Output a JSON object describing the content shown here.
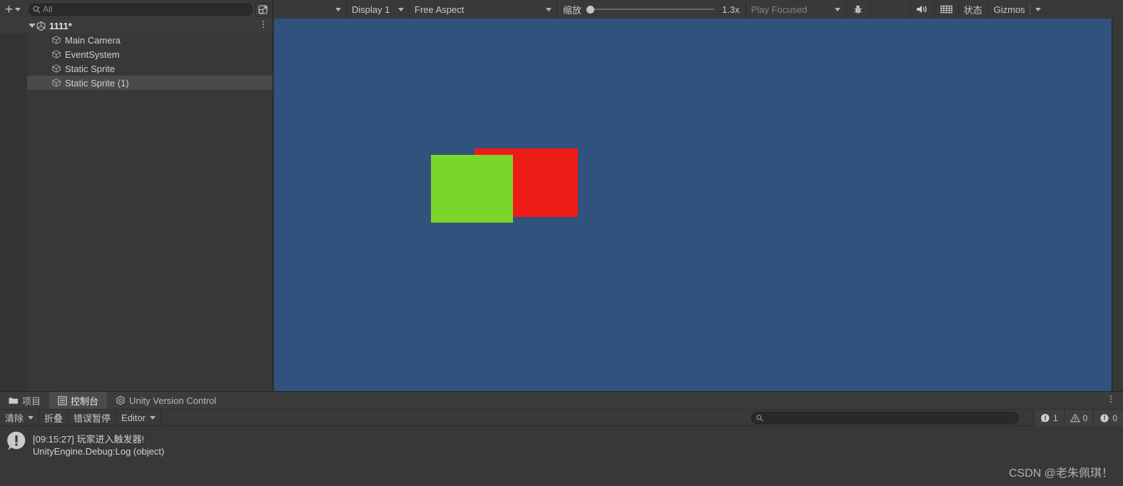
{
  "hierarchy_toolbar": {
    "add_label": "+",
    "add_icon": "plus-icon",
    "search_placeholder": "All",
    "search_value": "",
    "search_icon": "search-icon",
    "popout_icon": "popout-window-icon"
  },
  "game_toolbar": {
    "mode_dropdown_value": "",
    "display_value": "Display 1",
    "aspect_value": "Free Aspect",
    "zoom_label": "缩放",
    "zoom_value": "1.3x",
    "zoom_slider_position_pct": 0,
    "play_focused_value": "Play Focused",
    "debug_icon": "bug-icon",
    "mute_icon": "speaker-icon",
    "stats_grid_icon": "grid-icon",
    "stats_label": "状态",
    "gizmos_label": "Gizmos"
  },
  "hierarchy": {
    "scene_name": "1111*",
    "scene_icon": "unity-logo-icon",
    "menu_icon": "kebab-menu-icon",
    "items": [
      {
        "label": "Main Camera",
        "icon": "gameobject-cube-icon",
        "selected": false
      },
      {
        "label": "EventSystem",
        "icon": "gameobject-cube-icon",
        "selected": false
      },
      {
        "label": "Static Sprite",
        "icon": "gameobject-cube-icon",
        "selected": false
      },
      {
        "label": "Static Sprite (1)",
        "icon": "gameobject-cube-icon",
        "selected": true
      }
    ]
  },
  "game_view": {
    "background_color": "#31527d",
    "sprites": [
      {
        "name": "red-sprite",
        "color": "#ee1b17"
      },
      {
        "name": "green-sprite",
        "color": "#7ad62a"
      }
    ]
  },
  "console": {
    "tabs": [
      {
        "label": "项目",
        "icon": "folder-icon",
        "active": false
      },
      {
        "label": "控制台",
        "icon": "console-icon",
        "active": true
      },
      {
        "label": "Unity Version Control",
        "icon": "version-control-icon",
        "active": false
      }
    ],
    "menu_icon": "kebab-menu-icon",
    "toolbar": {
      "clear_label": "清除",
      "collapse_label": "折叠",
      "error_pause_label": "错误暂停",
      "editor_label": "Editor",
      "search_placeholder": "",
      "search_value": "",
      "search_icon": "search-icon"
    },
    "counters": {
      "log_count": "1",
      "warning_count": "0",
      "error_count": "0"
    },
    "entries": [
      {
        "icon": "info-log-icon",
        "message": "[09:15:27] 玩家进入触发器!",
        "stack": "UnityEngine.Debug:Log (object)"
      }
    ]
  },
  "watermark": {
    "text": "CSDN @老朱佩琪！"
  }
}
